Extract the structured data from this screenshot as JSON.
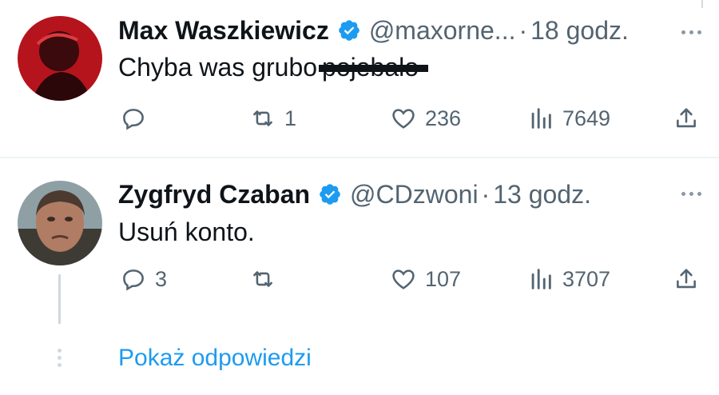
{
  "colors": {
    "text_primary": "#0f1419",
    "text_secondary": "#536471",
    "link": "#1d9bf0",
    "verified_badge": "#1d9bf0",
    "divider": "#eff3f4"
  },
  "tweets": [
    {
      "display_name": "Max Waszkiewicz",
      "handle": "@maxorne...",
      "separator": "·",
      "time": "18 godz.",
      "text": "Chyba was grubo",
      "redacted_text": "pojebało",
      "verified_icon": "verified-badge-icon",
      "actions": {
        "reply_count": "",
        "retweet_count": "1",
        "like_count": "236",
        "views_count": "7649"
      }
    },
    {
      "display_name": "Zygfryd Czaban",
      "handle": "@CDzwoni",
      "separator": "·",
      "time": "13 godz.",
      "text": "Usuń konto.",
      "verified_icon": "verified-badge-icon",
      "actions": {
        "reply_count": "3",
        "retweet_count": "",
        "like_count": "107",
        "views_count": "3707"
      }
    }
  ],
  "thread": {
    "show_replies_label": "Pokaż odpowiedzi"
  },
  "icons": [
    "reply-icon",
    "retweet-icon",
    "like-icon",
    "views-icon",
    "share-icon",
    "more-icon"
  ]
}
